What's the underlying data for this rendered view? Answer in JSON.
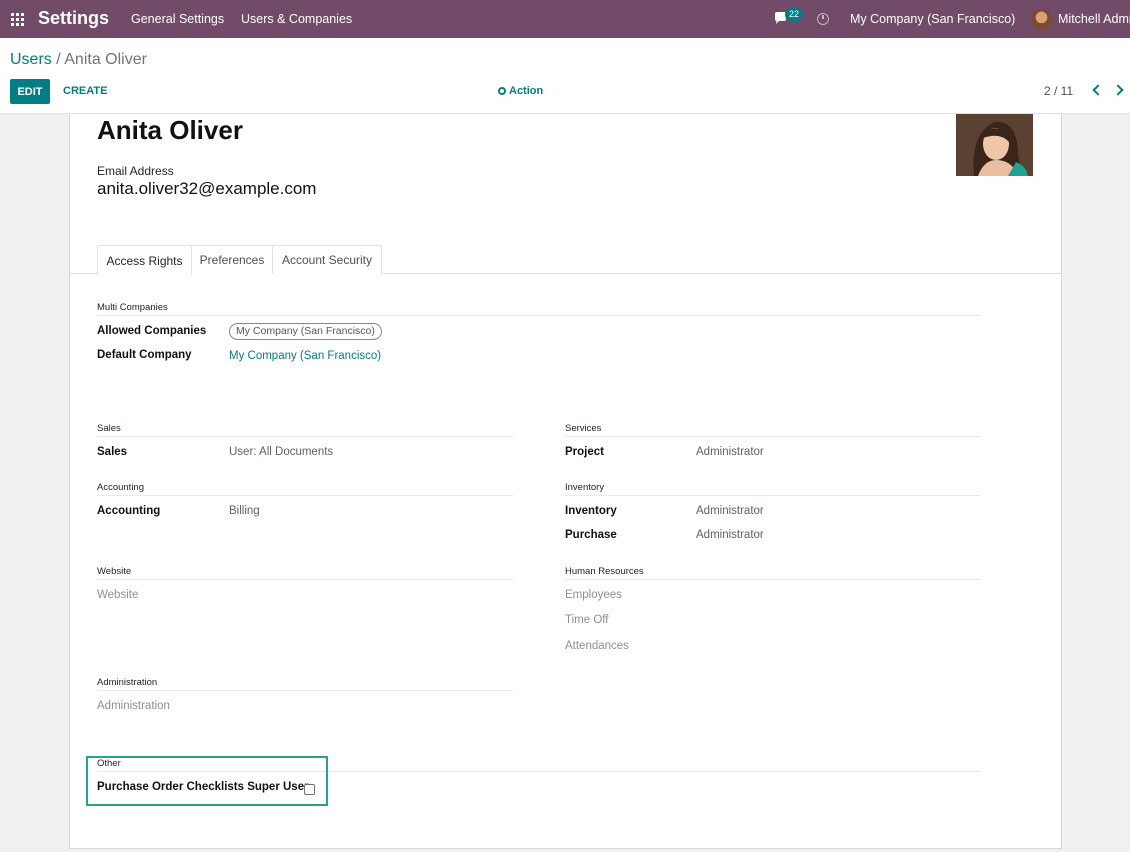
{
  "navbar": {
    "brand": "Settings",
    "menu": [
      "General Settings",
      "Users & Companies"
    ],
    "messages_badge": "22",
    "company": "My Company (San Francisco)",
    "user": "Mitchell Admin"
  },
  "control_panel": {
    "breadcrumb_parent": "Users",
    "breadcrumb_sep": "/",
    "breadcrumb_current": "Anita Oliver",
    "edit_label": "EDIT",
    "create_label": "CREATE",
    "action_label": "Action",
    "pager": "2 / 11"
  },
  "record": {
    "name": "Anita Oliver",
    "email_label": "Email Address",
    "email": "anita.oliver32@example.com"
  },
  "tabs": [
    "Access Rights",
    "Preferences",
    "Account Security"
  ],
  "multi_companies": {
    "title": "Multi Companies",
    "allowed_label": "Allowed Companies",
    "allowed_value": "My Company (San Francisco)",
    "default_label": "Default Company",
    "default_value": "My Company (San Francisco)"
  },
  "groups_left": [
    {
      "title": "Sales",
      "fields": [
        {
          "label": "Sales",
          "value": "User: All Documents"
        }
      ]
    },
    {
      "title": "Accounting",
      "fields": [
        {
          "label": "Accounting",
          "value": "Billing"
        }
      ]
    },
    {
      "title": "Website",
      "fields": [
        {
          "label": "Website",
          "value": ""
        }
      ]
    },
    {
      "title": "Administration",
      "fields": [
        {
          "label": "Administration",
          "value": ""
        }
      ]
    }
  ],
  "groups_right": [
    {
      "title": "Services",
      "fields": [
        {
          "label": "Project",
          "value": "Administrator"
        }
      ]
    },
    {
      "title": "Inventory",
      "fields": [
        {
          "label": "Inventory",
          "value": "Administrator"
        },
        {
          "label": "Purchase",
          "value": "Administrator"
        }
      ]
    },
    {
      "title": "Human Resources",
      "fields": [
        {
          "label": "Employees",
          "value": ""
        },
        {
          "label": "Time Off",
          "value": ""
        },
        {
          "label": "Attendances",
          "value": ""
        }
      ]
    }
  ],
  "other": {
    "title": "Other",
    "checkbox_label": "Purchase Order Checklists Super User",
    "checked": false
  }
}
